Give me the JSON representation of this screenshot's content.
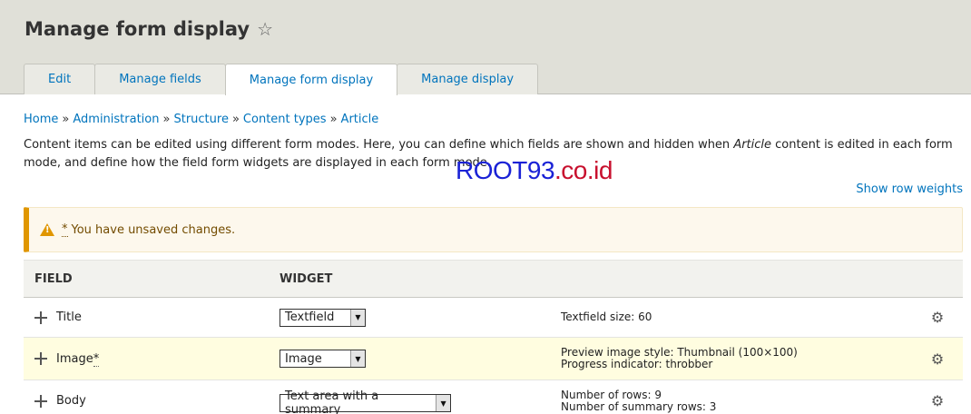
{
  "header": {
    "title": "Manage form display"
  },
  "tabs": [
    "Edit",
    "Manage fields",
    "Manage form display",
    "Manage display"
  ],
  "breadcrumb": [
    "Home",
    "Administration",
    "Structure",
    "Content types",
    "Article"
  ],
  "breadcrumb_separator": "»",
  "description": {
    "part1": "Content items can be edited using different form modes. Here, you can define which fields are shown and hidden when ",
    "emphasis": "Article",
    "part2": " content is edited in each form mode, and define how the field form widgets are displayed in each form mode."
  },
  "watermark": {
    "main": "ROOT93",
    "suffix": ".co.id"
  },
  "row_weights_link": "Show row weights",
  "warning": {
    "asterisk": "*",
    "text": "You have unsaved changes."
  },
  "table": {
    "headers": [
      "FIELD",
      "WIDGET"
    ],
    "rows": [
      {
        "field": "Title",
        "required_marker": "",
        "widget": "Textfield",
        "summary": [
          "Textfield size: 60"
        ]
      },
      {
        "field": "Image",
        "required_marker": "*",
        "widget": "Image",
        "summary": [
          "Preview image style: Thumbnail (100×100)",
          "Progress indicator: throbber"
        ]
      },
      {
        "field": "Body",
        "required_marker": "",
        "widget": "Text area with a summary",
        "summary": [
          "Number of rows: 9",
          "Number of summary rows: 3"
        ]
      }
    ]
  },
  "colors": {
    "link": "#0074bd",
    "warning_accent": "#e09600",
    "changed_row": "#fffde0"
  },
  "icons": {
    "favorite": "star-icon",
    "drag": "drag-handle-icon",
    "settings": "gear-icon",
    "warning": "warning-icon"
  }
}
